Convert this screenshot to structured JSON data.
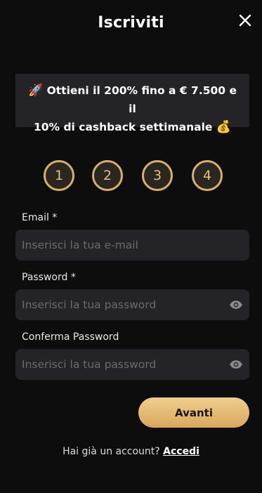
{
  "header": {
    "title": "Iscriviti",
    "close_icon": "close-icon"
  },
  "promo": {
    "icon_start": "🚀",
    "line1": "Ottieni il 200% fino a € 7.500 e il",
    "line2": "10% di cashback settimanale",
    "icon_end": "💰"
  },
  "steps": [
    "1",
    "2",
    "3",
    "4"
  ],
  "form": {
    "email": {
      "label": "Email *",
      "placeholder": "Inserisci la tua e-mail",
      "value": ""
    },
    "password": {
      "label": "Password *",
      "placeholder": "Inserisci la tua password",
      "value": ""
    },
    "confirm": {
      "label": "Conferma Password",
      "placeholder": "Inserisci la tua password",
      "value": ""
    }
  },
  "next_button": "Avanti",
  "footer": {
    "text": "Hai già un account?",
    "link": "Accedi"
  },
  "colors": {
    "background": "#0d0d0e",
    "panel": "#242428",
    "accent_gold": "#d8b068"
  }
}
